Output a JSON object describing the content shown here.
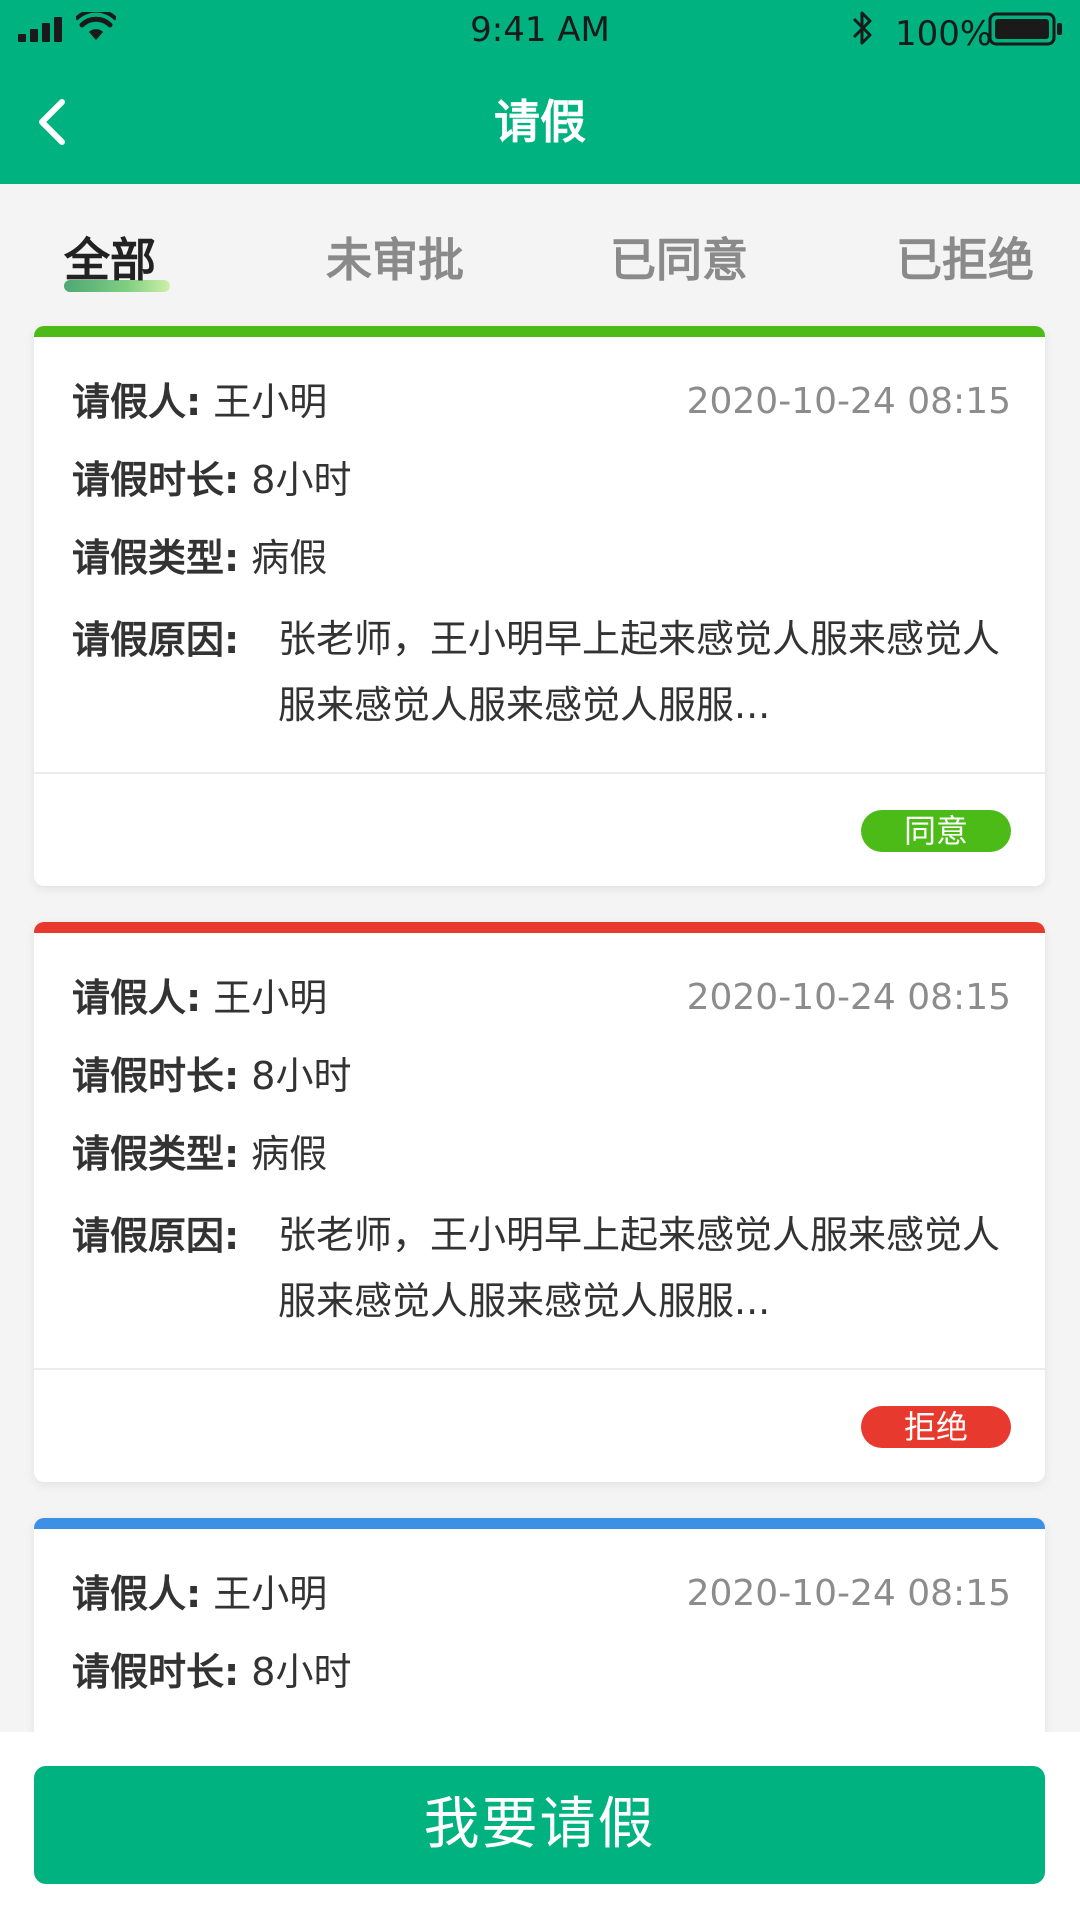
{
  "status_bar": {
    "time": "9:41 AM",
    "battery_percent": "100%",
    "icons": [
      "signal-icon",
      "wifi-icon",
      "bluetooth-icon",
      "battery-icon"
    ]
  },
  "header": {
    "title": "请假",
    "back_icon": "chevron-left-icon"
  },
  "tabs": [
    {
      "label": "全部",
      "active": true
    },
    {
      "label": "未审批",
      "active": false
    },
    {
      "label": "已同意",
      "active": false
    },
    {
      "label": "已拒绝",
      "active": false
    }
  ],
  "labels": {
    "person": "请假人:",
    "duration": "请假时长:",
    "type": "请假类型:",
    "reason": "请假原因:"
  },
  "cards": [
    {
      "person": "王小明",
      "date": "2020-10-24   08:15",
      "duration": "8小时",
      "type": "病假",
      "reason": "张老师，王小明早上起来感觉人服来感觉人服来感觉人服来感觉人服服...",
      "status": "同意",
      "bar_color": "#4cbb17",
      "status_color": "#4cbb17"
    },
    {
      "person": "王小明",
      "date": "2020-10-24   08:15",
      "duration": "8小时",
      "type": "病假",
      "reason": "张老师，王小明早上起来感觉人服来感觉人服来感觉人服来感觉人服服...",
      "status": "拒绝",
      "bar_color": "#e8392e",
      "status_color": "#e8392e"
    },
    {
      "person": "王小明",
      "date": "2020-10-24   08:15",
      "duration": "8小时",
      "bar_color": "#3c91e6"
    }
  ],
  "apply_button": "我要请假",
  "colors": {
    "primary": "#00b27f",
    "approved": "#4cbb17",
    "rejected": "#e8392e",
    "pending": "#3c91e6"
  }
}
